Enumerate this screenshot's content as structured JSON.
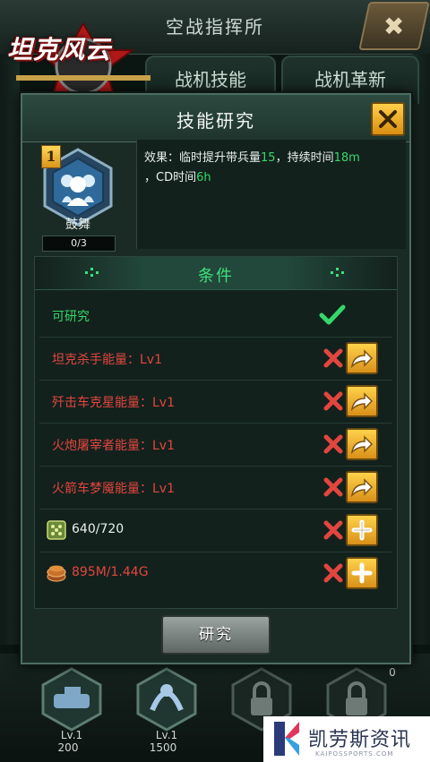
{
  "background": {
    "title": "空战指挥所",
    "logo_text": "坦克风云",
    "tabs": [
      "战机技能",
      "战机革新"
    ],
    "slots": [
      {
        "level": "Lv.1",
        "value": "200"
      },
      {
        "level": "Lv.1",
        "value": "1500"
      },
      {
        "level": "",
        "value": ""
      },
      {
        "level": "",
        "value": ""
      }
    ],
    "side_count": "0"
  },
  "watermark": {
    "text": "凯劳斯资讯",
    "sub": "KAIPOSSPORTS.COM"
  },
  "dialog": {
    "title": "技能研究",
    "skill": {
      "level_badge": "1",
      "name": "鼓舞",
      "progress": "0/3"
    },
    "effect": {
      "prefix": "效果：临时提升带兵量",
      "v1": "15",
      "mid": "，持续时间",
      "v2": "18m",
      "mid2": "，CD时间",
      "v3": "6h"
    },
    "conditions": {
      "title": "条件",
      "researchable_label": "可研究",
      "rows": [
        {
          "label": "坦克杀手能量：Lv1",
          "status": "unmet",
          "action": "go"
        },
        {
          "label": "歼击车克星能量：Lv1",
          "status": "unmet",
          "action": "go"
        },
        {
          "label": "火炮屠宰者能量：Lv1",
          "status": "unmet",
          "action": "go"
        },
        {
          "label": "火箭车梦魇能量：Lv1",
          "status": "unmet",
          "action": "go"
        },
        {
          "label": "640/720",
          "status": "unmet",
          "action": "add",
          "icon": "medal-icon"
        },
        {
          "label": "895M/1.44G",
          "status": "unmet",
          "action": "add",
          "icon": "fuel-icon"
        }
      ]
    },
    "research_button": "研究"
  },
  "colors": {
    "accent_green": "#37d86a",
    "warning_red": "#e2463e",
    "button_gold": "#ffd24a"
  }
}
